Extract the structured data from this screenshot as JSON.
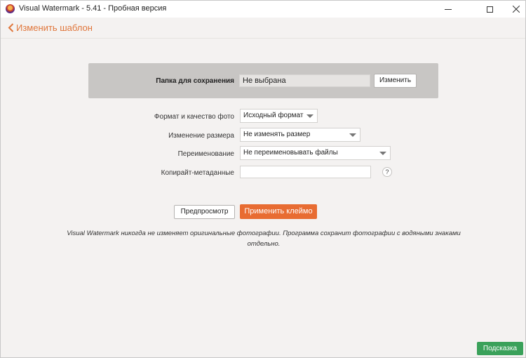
{
  "window": {
    "title": "Visual Watermark - 5.41 - Пробная версия"
  },
  "header": {
    "back_label": "Изменить шаблон"
  },
  "save_folder": {
    "label": "Папка для сохранения",
    "value": "Не выбрана",
    "change_label": "Изменить"
  },
  "form": {
    "format": {
      "label": "Формат и качество фото",
      "value": "Исходный формат"
    },
    "resize": {
      "label": "Изменение размера",
      "value": "Не изменять размер"
    },
    "rename": {
      "label": "Переименование",
      "value": "Не переименовывать файлы"
    },
    "copyright": {
      "label": "Копирайт-метаданные",
      "value": "",
      "help": "?"
    }
  },
  "actions": {
    "preview_label": "Предпросмотр",
    "apply_label": "Применить клеймо"
  },
  "note": "Visual Watermark никогда не изменяет оригинальные фотографии. Программа сохранит фотографии с водяными знаками отдельно.",
  "footer": {
    "help_label": "Подсказка"
  },
  "colors": {
    "accent": "#e86c32",
    "help_green": "#3aa15a",
    "panel_gray": "#c8c6c4"
  }
}
